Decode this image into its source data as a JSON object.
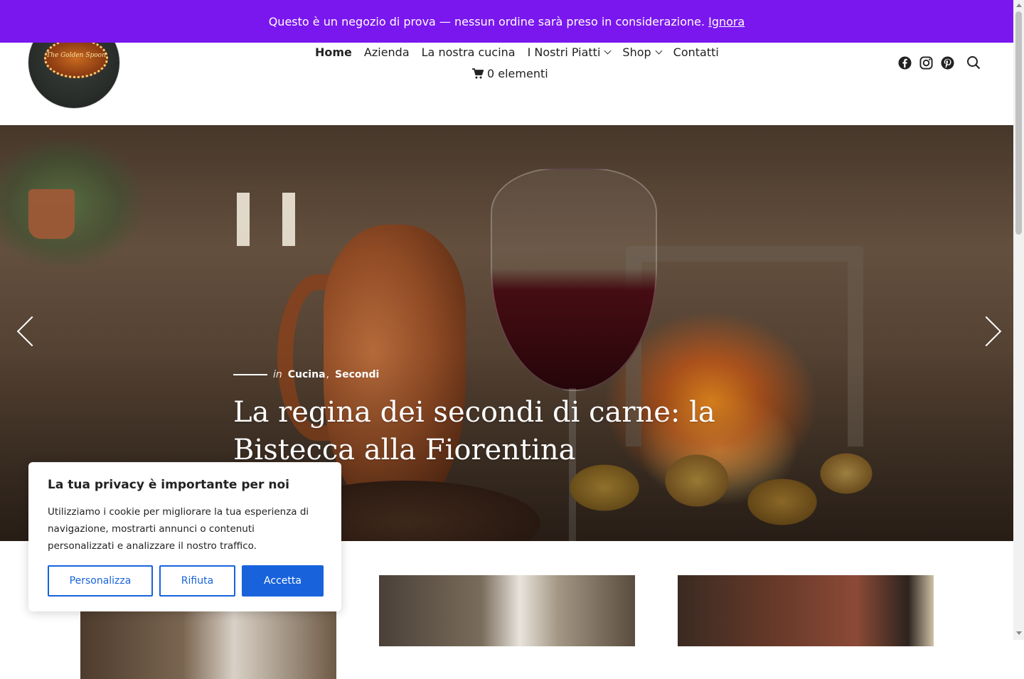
{
  "notice": {
    "text": "Questo è un negozio di prova — nessun ordine sarà preso in considerazione.",
    "dismiss": "Ignora"
  },
  "header": {
    "logo_text": "The Golden Spoon",
    "nav": [
      {
        "label": "Home",
        "active": true
      },
      {
        "label": "Azienda"
      },
      {
        "label": "La nostra cucina"
      },
      {
        "label": "I Nostri Piatti",
        "dropdown": true
      },
      {
        "label": "Shop",
        "dropdown": true
      },
      {
        "label": "Contatti"
      }
    ],
    "cart": "0 elementi",
    "social_icons": [
      "facebook-icon",
      "instagram-icon",
      "pinterest-icon",
      "search-icon"
    ]
  },
  "hero": {
    "meta_prefix": "in",
    "categories": [
      "Cucina",
      "Secondi"
    ],
    "title": "La regina dei secondi di carne: la Bistecca alla Fiorentina"
  },
  "cookie": {
    "title": "La tua privacy è importante per noi",
    "body": "Utilizziamo i cookie per migliorare la tua esperienza di navigazione, mostrarti annunci o contenuti personalizzati e analizzare il nostro traffico.",
    "buttons": {
      "customize": "Personalizza",
      "reject": "Rifiuta",
      "accept": "Accetta"
    }
  },
  "colors": {
    "notice_bg": "#7a17ee",
    "accent": "#1863dc"
  }
}
